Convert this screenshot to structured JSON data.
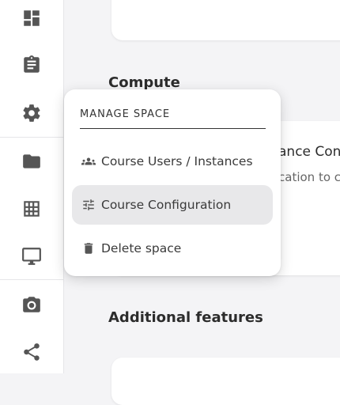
{
  "nav": {
    "icons": [
      "dashboard-icon",
      "assignment-icon",
      "settings-icon",
      "folder-icon",
      "table-icon",
      "desktop-icon",
      "camera-icon",
      "share-icon"
    ]
  },
  "content": {
    "compute_heading": "Compute",
    "card_title_fragment": "ance Con",
    "card_desc_fragment": "cation to c",
    "additional_heading": "Additional features"
  },
  "menu": {
    "header": "MANAGE SPACE",
    "items": [
      {
        "label": "Course Users / Instances",
        "icon": "users-icon",
        "active": false
      },
      {
        "label": "Course Configuration",
        "icon": "tune-icon",
        "active": true
      },
      {
        "label": "Delete space",
        "icon": "trash-icon",
        "active": false
      }
    ]
  },
  "colors": {
    "background": "#f4f4f6",
    "active_item": "#e8e8ea",
    "icon": "#555555"
  }
}
